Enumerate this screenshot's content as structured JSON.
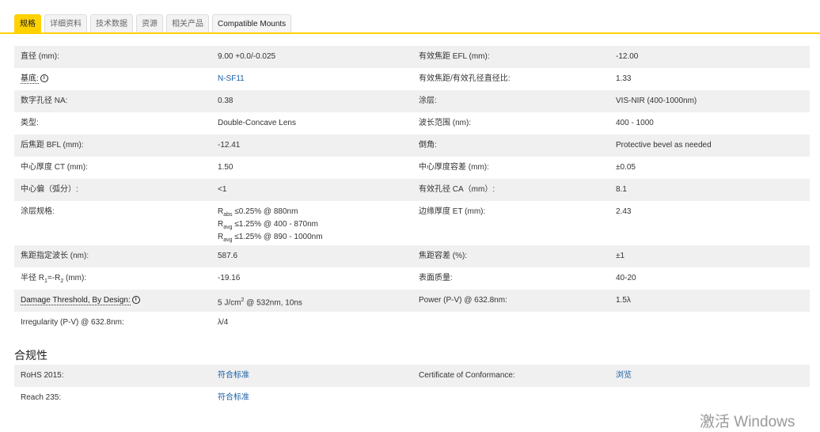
{
  "tabs": [
    {
      "label": "规格",
      "active": true
    },
    {
      "label": "详细资料"
    },
    {
      "label": "技术数据"
    },
    {
      "label": "资源"
    },
    {
      "label": "相关产品"
    },
    {
      "label": "Compatible Mounts",
      "strong": true
    }
  ],
  "specs": [
    [
      [
        {
          "t": "直径 (mm):"
        }
      ],
      [
        {
          "t": "9.00 +0.0/-0.025"
        }
      ],
      [
        {
          "t": "有效焦距 EFL (mm):"
        }
      ],
      [
        {
          "t": "-12.00"
        }
      ]
    ],
    [
      [
        {
          "t": "基底:",
          "tip": true
        }
      ],
      [
        {
          "t": "N-SF11",
          "link": true
        }
      ],
      [
        {
          "t": "有效焦距/有效孔径直径比:"
        }
      ],
      [
        {
          "t": "1.33"
        }
      ]
    ],
    [
      [
        {
          "t": "数字孔径 NA:"
        }
      ],
      [
        {
          "t": "0.38"
        }
      ],
      [
        {
          "t": "涂层:"
        }
      ],
      [
        {
          "t": "VIS-NIR (400-1000nm)"
        }
      ]
    ],
    [
      [
        {
          "t": "类型:"
        }
      ],
      [
        {
          "t": "Double-Concave Lens"
        }
      ],
      [
        {
          "t": "波长范围 (nm):"
        }
      ],
      [
        {
          "t": "400 - 1000"
        }
      ]
    ],
    [
      [
        {
          "t": "后焦距 BFL (mm):"
        }
      ],
      [
        {
          "t": "-12.41"
        }
      ],
      [
        {
          "t": "倒角:"
        }
      ],
      [
        {
          "t": "Protective bevel as needed"
        }
      ]
    ],
    [
      [
        {
          "t": "中心厚度 CT (mm):"
        }
      ],
      [
        {
          "t": "1.50"
        }
      ],
      [
        {
          "t": "中心厚度容差 (mm):"
        }
      ],
      [
        {
          "t": "±0.05"
        }
      ]
    ],
    [
      [
        {
          "t": "中心偏（弧分）:"
        }
      ],
      [
        {
          "t": "<1"
        }
      ],
      [
        {
          "t": "有效孔径 CA（mm）:"
        }
      ],
      [
        {
          "t": "8.1"
        }
      ]
    ],
    [
      [
        {
          "t": "涂层规格:"
        }
      ],
      [
        {
          "t": "R",
          "line": true
        },
        {
          "t": "abs",
          "sub": true
        },
        {
          "t": " ≤0.25% @ 880nm"
        },
        {
          "t": "R",
          "line": true
        },
        {
          "t": "avg",
          "sub": true
        },
        {
          "t": " ≤1.25% @ 400 - 870nm"
        },
        {
          "t": "R",
          "line": true
        },
        {
          "t": "avg",
          "sub": true
        },
        {
          "t": " ≤1.25% @ 890 - 1000nm"
        }
      ],
      [
        {
          "t": "边缘厚度 ET (mm):"
        }
      ],
      [
        {
          "t": "2.43"
        }
      ]
    ],
    [
      [
        {
          "t": "焦距指定波长 (nm):"
        }
      ],
      [
        {
          "t": "587.6"
        }
      ],
      [
        {
          "t": "焦距容差 (%):"
        }
      ],
      [
        {
          "t": "±1"
        }
      ]
    ],
    [
      [
        {
          "t": "半径 R"
        },
        {
          "t": "1",
          "sub": true
        },
        {
          "t": "=-R"
        },
        {
          "t": "2",
          "sub": true
        },
        {
          "t": " (mm):"
        }
      ],
      [
        {
          "t": "-19.16"
        }
      ],
      [
        {
          "t": "表面质量:"
        }
      ],
      [
        {
          "t": "40-20"
        }
      ]
    ],
    [
      [
        {
          "t": "Damage Threshold, By Design:",
          "tip": true
        }
      ],
      [
        {
          "t": "5 J/cm"
        },
        {
          "t": "2",
          "sup": true
        },
        {
          "t": " @ 532nm, 10ns"
        }
      ],
      [
        {
          "t": "Power (P-V) @ 632.8nm:"
        }
      ],
      [
        {
          "t": "1.5λ"
        }
      ]
    ],
    [
      [
        {
          "t": "Irregularity (P-V) @ 632.8nm:"
        }
      ],
      [
        {
          "t": "λ/4"
        }
      ],
      [],
      []
    ]
  ],
  "compliance_title": "合规性",
  "compliance": [
    [
      [
        {
          "t": "RoHS 2015:"
        }
      ],
      [
        {
          "t": "符合标准",
          "link": true
        }
      ],
      [
        {
          "t": "Certificate of Conformance:"
        }
      ],
      [
        {
          "t": "浏览",
          "link": true
        }
      ]
    ],
    [
      [
        {
          "t": "Reach 235:"
        }
      ],
      [
        {
          "t": "符合标准",
          "link": true
        }
      ],
      [],
      []
    ]
  ],
  "info_glyph": "i",
  "watermark": "激活 Windows"
}
